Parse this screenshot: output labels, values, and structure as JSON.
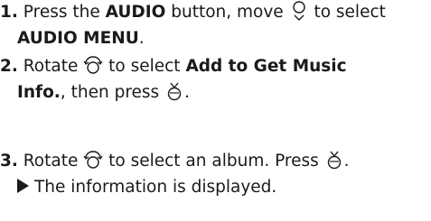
{
  "steps": [
    {
      "number": "1.",
      "line1": {
        "t1": " Press the ",
        "b1": "AUDIO",
        "t2": " button, move ",
        "t3": " to select"
      },
      "line2": {
        "b1": "AUDIO MENU",
        "t1": "."
      }
    },
    {
      "number": "2.",
      "line1": {
        "t1": " Rotate ",
        "t2": " to select ",
        "b1": "Add to Get Music"
      },
      "line2": {
        "b1": "Info.",
        "t1": ", then press ",
        "t2": "."
      }
    },
    {
      "number": "3.",
      "line1": {
        "t1": " Rotate ",
        "t2": " to select an album. Press ",
        "t3": "."
      },
      "result": "The information is displayed."
    }
  ],
  "icons": {
    "move_down": "interface-dial-move-down-icon",
    "rotate": "interface-dial-rotate-icon",
    "press": "interface-dial-press-icon"
  },
  "colors": {
    "text": "#1a1a1a"
  }
}
